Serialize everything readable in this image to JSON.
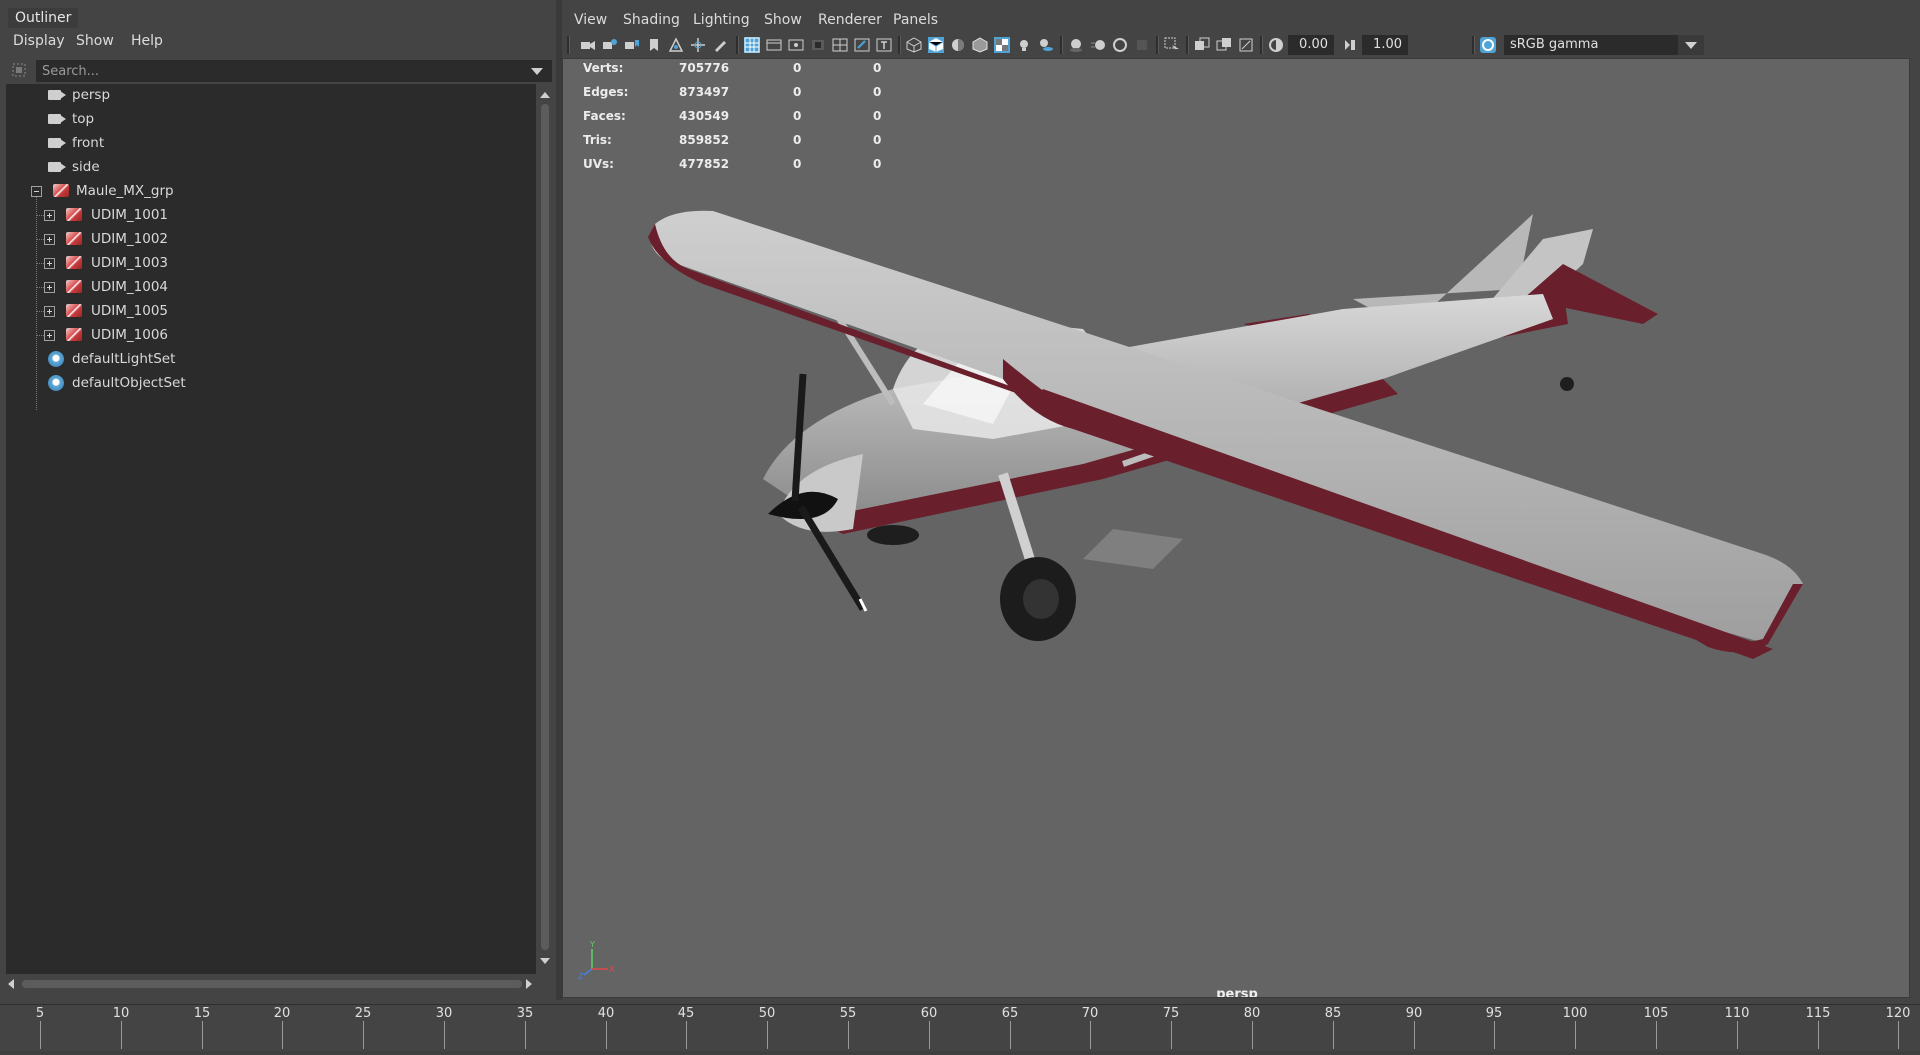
{
  "outliner": {
    "tab_label": "Outliner",
    "menu": [
      "Display",
      "Show",
      "Help"
    ],
    "search_placeholder": "Search...",
    "tree": {
      "cameras": [
        "persp",
        "top",
        "front",
        "side"
      ],
      "group": "Maule_MX_grp",
      "children": [
        "UDIM_1001",
        "UDIM_1002",
        "UDIM_1003",
        "UDIM_1004",
        "UDIM_1005",
        "UDIM_1006"
      ],
      "sets": [
        "defaultLightSet",
        "defaultObjectSet"
      ]
    }
  },
  "viewport": {
    "menu": [
      "View",
      "Shading",
      "Lighting",
      "Show",
      "Renderer",
      "Panels"
    ],
    "toolbar": {
      "exposure": "0.00",
      "gamma": "1.00",
      "color_space": "sRGB gamma",
      "accent_color": "#4fa3d6"
    },
    "hud": {
      "rows": [
        {
          "label": "Verts:",
          "values": [
            "705776",
            "0",
            "0"
          ]
        },
        {
          "label": "Edges:",
          "values": [
            "873497",
            "0",
            "0"
          ]
        },
        {
          "label": "Faces:",
          "values": [
            "430549",
            "0",
            "0"
          ]
        },
        {
          "label": "Tris:",
          "values": [
            "859852",
            "0",
            "0"
          ]
        },
        {
          "label": "UVs:",
          "values": [
            "477852",
            "0",
            "0"
          ]
        }
      ]
    },
    "camera_label": "persp",
    "axis_labels": {
      "y": "Y",
      "x": "X",
      "z": "Z"
    },
    "background_color": "#646464",
    "plane_stripe_color": "#6a1f2c"
  },
  "timeslider": {
    "ticks": [
      "5",
      "10",
      "15",
      "20",
      "25",
      "30",
      "35",
      "40",
      "45",
      "50",
      "55",
      "60",
      "65",
      "70",
      "75",
      "80",
      "85",
      "90",
      "95",
      "100",
      "105",
      "110",
      "115",
      "120"
    ]
  }
}
